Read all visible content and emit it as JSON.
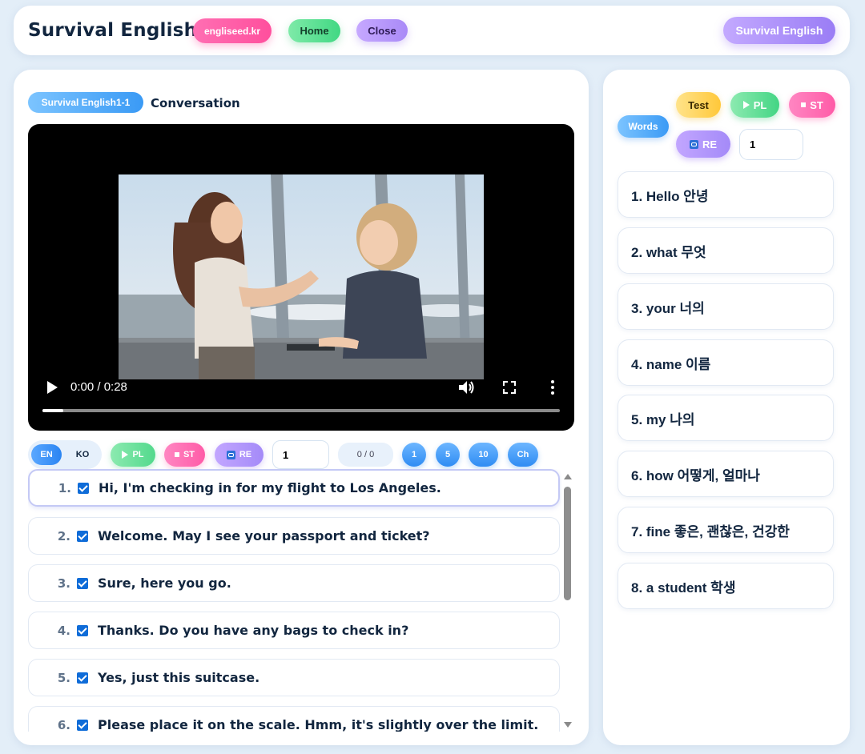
{
  "header": {
    "title": "Survival English 1",
    "brand_label": "engliseed.kr",
    "home_label": "Home",
    "close_label": "Close",
    "course_label": "Survival English"
  },
  "lesson": {
    "badge": "Survival English1-1",
    "label": "Conversation"
  },
  "video": {
    "time": "0:00 / 0:28",
    "progress_fraction": 0.04
  },
  "controls": {
    "lang_en": "EN",
    "lang_ko": "KO",
    "play_label": "PL",
    "stop_label": "ST",
    "repeat_label": "RE",
    "repeat_value": "1",
    "counter": "0 / 0",
    "num_buttons": [
      "1",
      "5",
      "10",
      "Ch"
    ]
  },
  "sentences": [
    {
      "num": "1.",
      "text": "Hi, I'm checking in for my flight to Los Angeles.",
      "checked": true
    },
    {
      "num": "2.",
      "text": "Welcome. May I see your passport and ticket?",
      "checked": true
    },
    {
      "num": "3.",
      "text": "Sure, here you go.",
      "checked": true
    },
    {
      "num": "4.",
      "text": "Thanks. Do you have any bags to check in?",
      "checked": true
    },
    {
      "num": "5.",
      "text": "Yes, just this suitcase.",
      "checked": true
    },
    {
      "num": "6.",
      "text": "Please place it on the scale. Hmm, it's slightly over the limit.",
      "checked": true
    }
  ],
  "words_panel": {
    "badge": "Words",
    "test_label": "Test",
    "play_label": "PL",
    "stop_label": "ST",
    "repeat_label": "RE",
    "repeat_value": "1",
    "items": [
      "1. Hello 안녕",
      "2. what 무엇",
      "3. your 너의",
      "4. name 이름",
      "5. my 나의",
      "6. how 어떻게, 얼마나",
      "7. fine 좋은, 괜찮은, 건강한",
      "8. a student 학생"
    ]
  },
  "colors": {
    "accent_blue": "#2f8cf3",
    "accent_green": "#43d584",
    "accent_pink": "#ff5ba7",
    "accent_purple": "#a48af8",
    "accent_yellow": "#ffc83a",
    "page_bg": "#e3eef8"
  }
}
